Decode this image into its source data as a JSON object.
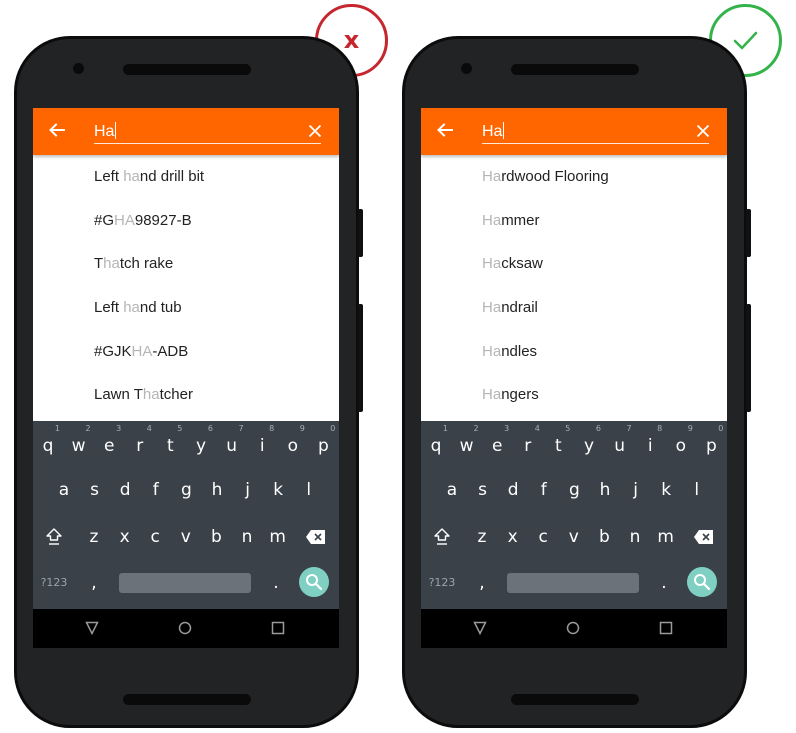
{
  "badges": {
    "wrong": {
      "label": "x",
      "color": "#c6262e"
    },
    "right": {
      "icon": "checkmark-icon",
      "color": "#34b34a"
    }
  },
  "colors": {
    "appbar": "#ff6600",
    "keyboard": "#3a4149",
    "highlight": "#b5b5b5"
  },
  "search": {
    "query": "Ha"
  },
  "phones": [
    {
      "id": "bad",
      "results": [
        {
          "pre": "Left ",
          "hl": "ha",
          "post": "nd drill bit"
        },
        {
          "pre": "#G",
          "hl": "HA",
          "post": "98927-B"
        },
        {
          "pre": "T",
          "hl": "ha",
          "post": "tch rake"
        },
        {
          "pre": "Left ",
          "hl": "ha",
          "post": "nd tub"
        },
        {
          "pre": "#GJK",
          "hl": "HA",
          "post": "-ADB"
        },
        {
          "pre": "Lawn T",
          "hl": "ha",
          "post": "tcher"
        }
      ]
    },
    {
      "id": "good",
      "results": [
        {
          "pre": "",
          "hl": "Ha",
          "post": "rdwood Flooring"
        },
        {
          "pre": "",
          "hl": "Ha",
          "post": "mmer"
        },
        {
          "pre": "",
          "hl": "Ha",
          "post": "cksaw"
        },
        {
          "pre": "",
          "hl": "Ha",
          "post": "ndrail"
        },
        {
          "pre": "",
          "hl": "Ha",
          "post": "ndles"
        },
        {
          "pre": "",
          "hl": "Ha",
          "post": "ngers"
        }
      ]
    }
  ],
  "keyboard": {
    "row1": [
      "q",
      "w",
      "e",
      "r",
      "t",
      "y",
      "u",
      "i",
      "o",
      "p"
    ],
    "hints": [
      "1",
      "2",
      "3",
      "4",
      "5",
      "6",
      "7",
      "8",
      "9",
      "0"
    ],
    "row2": [
      "a",
      "s",
      "d",
      "f",
      "g",
      "h",
      "j",
      "k",
      "l"
    ],
    "row3": [
      "z",
      "x",
      "c",
      "v",
      "b",
      "n",
      "m"
    ],
    "symbols_label": "?123",
    "comma": ",",
    "period": "."
  }
}
